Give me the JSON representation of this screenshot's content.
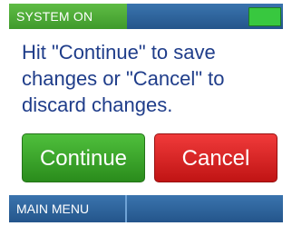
{
  "status_bar": {
    "label": "SYSTEM ON",
    "indicator_color": "#38c83f"
  },
  "dialog": {
    "message": "Hit \"Continue\" to save\nchanges or \"Cancel\" to\ndiscard changes.",
    "continue_label": "Continue",
    "cancel_label": "Cancel"
  },
  "bottom_bar": {
    "menu_label": "MAIN MENU"
  },
  "colors": {
    "bar_blue": "#24558b",
    "green": "#2a8c1c",
    "red": "#c01414",
    "text_blue": "#1f3d8a"
  }
}
